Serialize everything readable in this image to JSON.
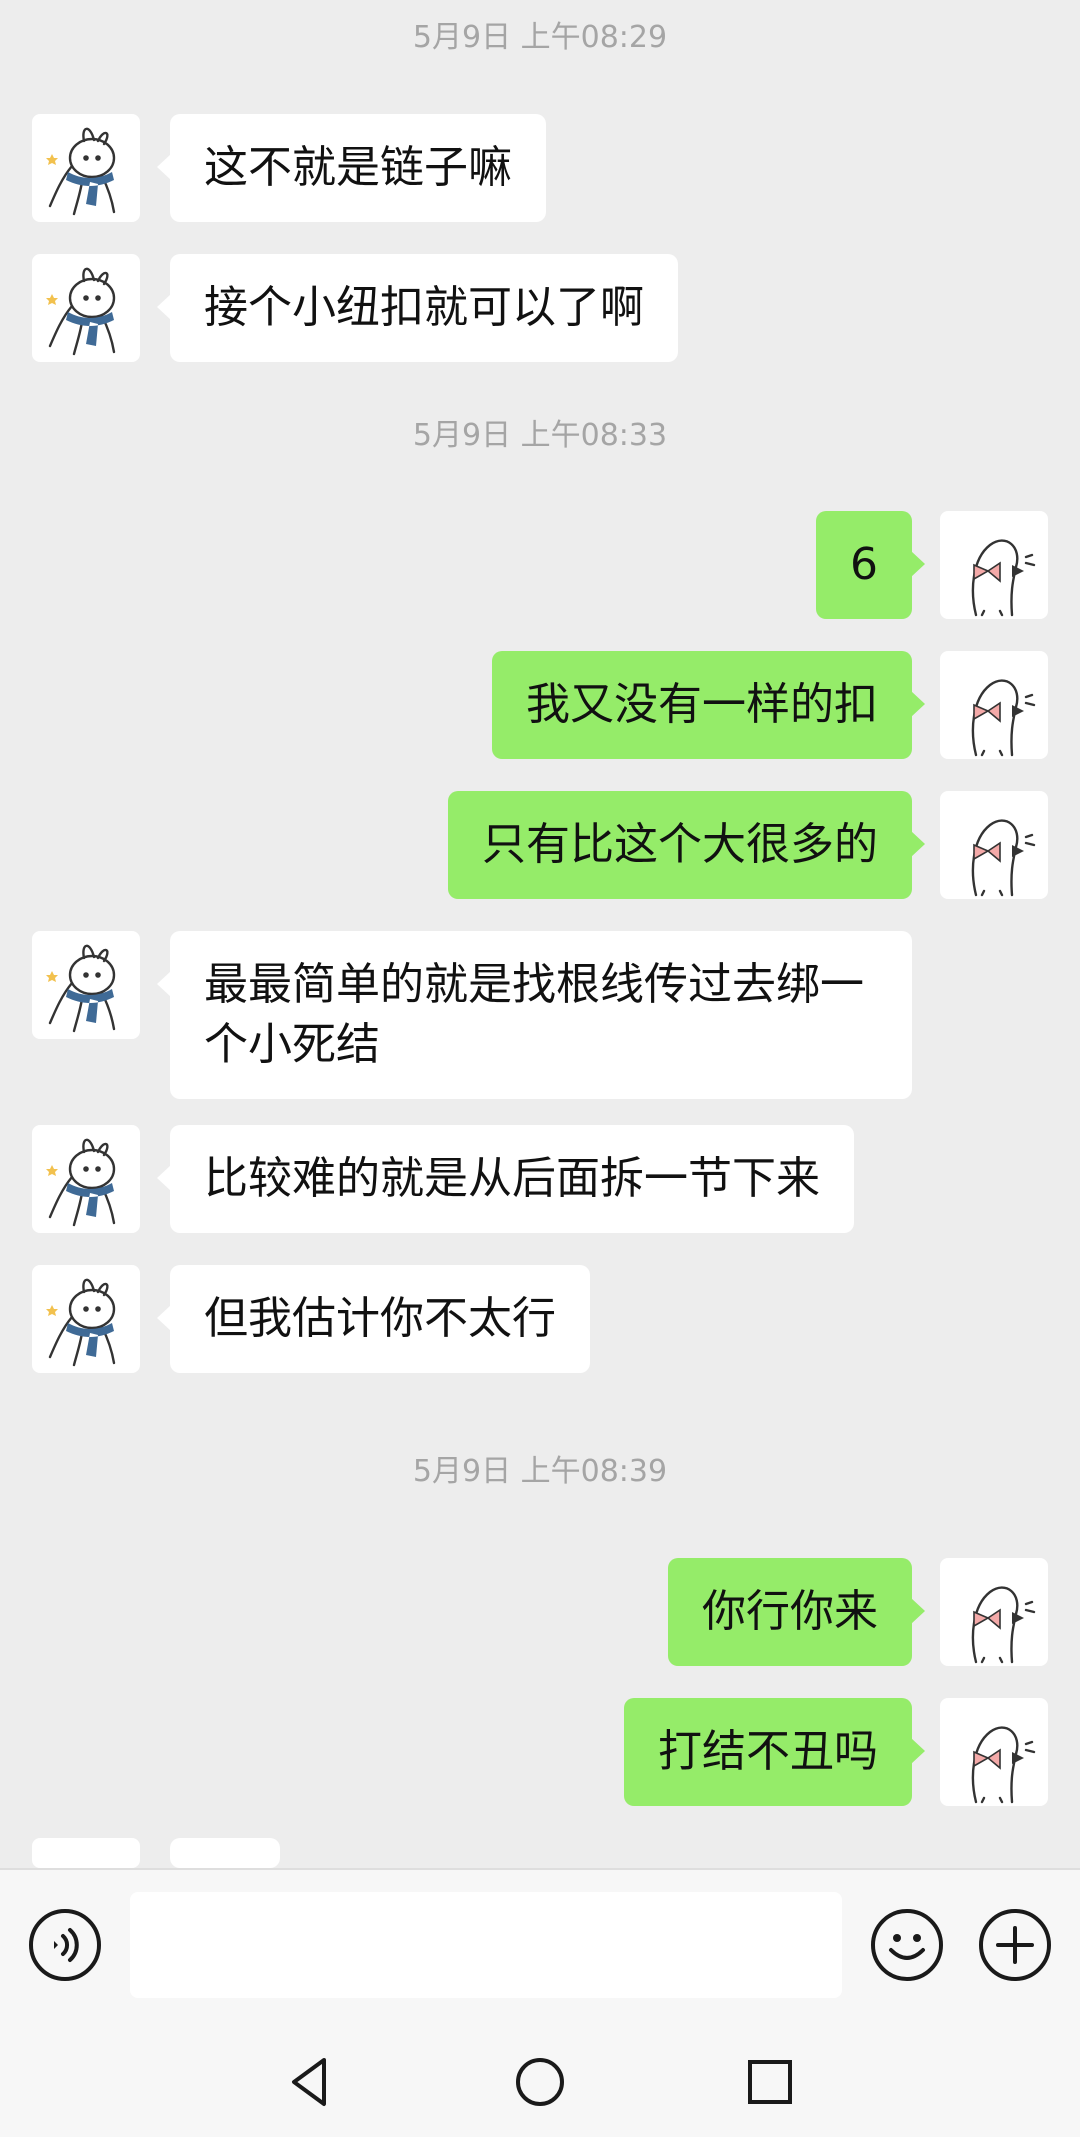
{
  "chat": {
    "timestamps": [
      "5月9日 上午08:29",
      "5月9日 上午08:33",
      "5月9日 上午08:39"
    ],
    "messages": [
      {
        "from": "left",
        "text": "这不就是链子嘛"
      },
      {
        "from": "left",
        "text": "接个小纽扣就可以了啊"
      },
      {
        "from": "right",
        "text": "6"
      },
      {
        "from": "right",
        "text": "我又没有一样的扣"
      },
      {
        "from": "right",
        "text": "只有比这个大很多的"
      },
      {
        "from": "left",
        "text": "最最简单的就是找根线传过去绑一\n个小死结"
      },
      {
        "from": "left",
        "text": "比较难的就是从后面拆一节下来"
      },
      {
        "from": "left",
        "text": "但我估计你不太行"
      },
      {
        "from": "right",
        "text": "你行你来"
      },
      {
        "from": "right",
        "text": "打结不丑吗"
      }
    ]
  },
  "input": {
    "placeholder": "",
    "value": ""
  },
  "icons": {
    "voice": "voice-icon",
    "emoji": "emoji-icon",
    "plus": "plus-icon",
    "back": "back-triangle-icon",
    "home": "home-circle-icon",
    "recents": "recents-square-icon"
  },
  "colors": {
    "background": "#ededed",
    "outgoing_bubble": "#95ec69",
    "incoming_bubble": "#ffffff",
    "timestamp": "#a5a5a5"
  }
}
